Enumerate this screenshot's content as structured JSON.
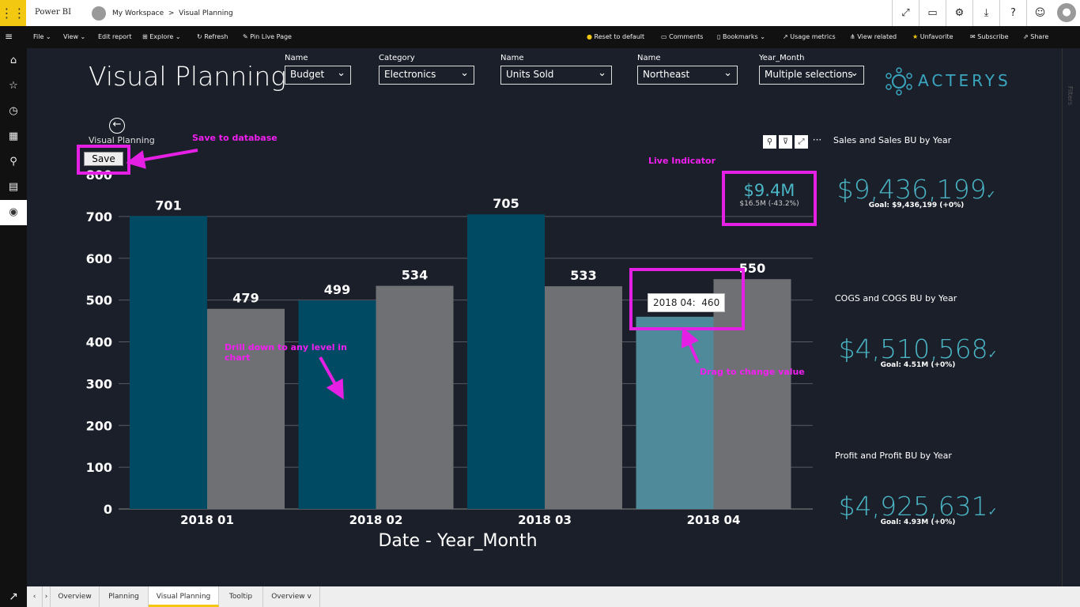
{
  "app": {
    "brand": "Power BI",
    "breadcrumb": [
      "My Workspace",
      "Visual Planning"
    ]
  },
  "topbar_icons": [
    "expand-icon",
    "present-icon",
    "settings-icon",
    "download-icon",
    "help-icon",
    "feedback-icon"
  ],
  "cmdbar": {
    "left": [
      "File",
      "View",
      "Edit report",
      "Explore",
      "Refresh",
      "Pin Live Page"
    ],
    "right": [
      "Reset to default",
      "Comments",
      "Bookmarks",
      "Usage metrics",
      "View related",
      "Unfavorite",
      "Subscribe",
      "Share"
    ]
  },
  "page": {
    "title": "Visual Planning"
  },
  "slicers": [
    {
      "label": "Name",
      "value": "Budget"
    },
    {
      "label": "Category",
      "value": "Electronics"
    },
    {
      "label": "Name",
      "value": "Units Sold"
    },
    {
      "label": "Name",
      "value": "Northeast"
    },
    {
      "label": "Year_Month",
      "value": "Multiple selections"
    }
  ],
  "logo": {
    "text": "ACTERYS"
  },
  "visual": {
    "name": "Visual Planning",
    "save_label": "Save"
  },
  "annotations": {
    "save": "Save to database",
    "live": "Live Indicator",
    "drill": "Drill down to any level in chart",
    "drag": "Drag to change value"
  },
  "live_indicator": {
    "value": "$9.4M",
    "sub": "$16.5M (-43.2%)"
  },
  "kpis": [
    {
      "title": "Sales and Sales BU by Year",
      "value": "$9,436,199",
      "goal": "Goal: $9,436,199 (+0%)"
    },
    {
      "title": "COGS and COGS BU by Year",
      "value": "$4,510,568",
      "goal": "Goal: 4.51M (+0%)"
    },
    {
      "title": "Profit and Profit BU by Year",
      "value": "$4,925,631",
      "goal": "Goal: 4.93M (+0%)"
    }
  ],
  "tooltip": {
    "text": "2018 04:  460"
  },
  "colors": {
    "dark_bar": "#004a63",
    "grey_bar": "#6e7074",
    "highlight_bar": "#4f8a9b",
    "accent": "#e61fe4",
    "kpi": "#4ab5c4"
  },
  "chart_data": {
    "type": "bar",
    "categories": [
      "2018 01",
      "2018 02",
      "2018 03",
      "2018 04"
    ],
    "series": [
      {
        "values": [
          701,
          499,
          705,
          460
        ]
      },
      {
        "values": [
          479,
          534,
          533,
          550
        ]
      }
    ],
    "data_labels": [
      [
        "701",
        "499",
        "705",
        ""
      ],
      [
        "479",
        "534",
        "533",
        "550"
      ]
    ],
    "xlabel": "Date - Year_Month",
    "ylabel": "",
    "ylim": [
      0,
      800
    ],
    "yticks": [
      0,
      100,
      200,
      300,
      400,
      500,
      600,
      700,
      800
    ],
    "grid": true
  },
  "tabs": [
    "Overview",
    "Planning",
    "Visual Planning",
    "Tooltip",
    "Overview v"
  ],
  "active_tab": "Visual Planning",
  "filters_label": "Filters"
}
